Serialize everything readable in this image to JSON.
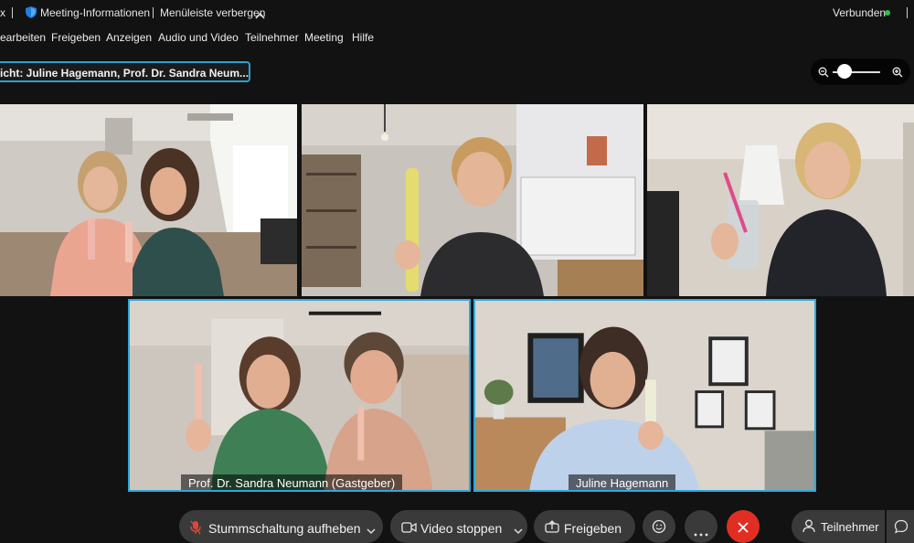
{
  "titlebar": {
    "app_fragment": "x",
    "meeting_info": "Meeting-Informationen",
    "hide_menu": "Menüleiste verbergen",
    "status": "Verbunden",
    "status_color": "#2ec24a"
  },
  "menu": {
    "items": [
      "earbeiten",
      "Freigeben",
      "Anzeigen",
      "Audio und Video",
      "Teilnehmer",
      "Meeting",
      "Hilfe"
    ]
  },
  "view": {
    "label": "icht: Juline Hagemann, Prof. Dr. Sandra Neum..."
  },
  "tiles": {
    "bottom_left_name": "Prof. Dr. Sandra Neumann (Gastgeber)",
    "bottom_right_name": "Juline Hagemann"
  },
  "toolbar": {
    "unmute": "Stummschaltung aufheben",
    "video": "Video stoppen",
    "share": "Freigeben",
    "participants": "Teilnehmer",
    "end_color": "#e02f22"
  },
  "colors": {
    "accent": "#2ea8dc"
  }
}
